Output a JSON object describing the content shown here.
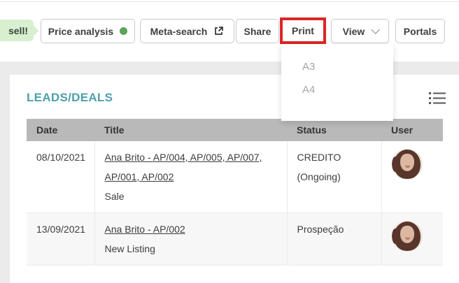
{
  "toolbar": {
    "sell_badge_label": "sell!",
    "buttons": [
      {
        "label": "Price analysis"
      },
      {
        "label": "Meta-search"
      },
      {
        "label": "Share"
      },
      {
        "label": "Print"
      },
      {
        "label": "View"
      },
      {
        "label": "Portals"
      }
    ]
  },
  "print_menu": {
    "items": [
      "A3",
      "A4"
    ]
  },
  "panel": {
    "title": "LEADS/DEALS"
  },
  "table": {
    "columns": [
      "Date",
      "Title",
      "Status",
      "User"
    ],
    "rows": [
      {
        "date": "08/10/2021",
        "title_link": "Ana Brito - AP/004, AP/005, AP/007, AP/001, AP/002",
        "subtitle": "Sale",
        "status": "CREDITO (Ongoing)"
      },
      {
        "date": "13/09/2021",
        "title_link": "Ana Brito - AP/002",
        "subtitle": "New Listing",
        "status": "Prospeção"
      }
    ]
  },
  "icons": {
    "price_analysis_dot": "green-status-dot",
    "meta_search": "external-link-icon",
    "view": "chevron-down-icon",
    "panel": "list-view-icon",
    "user": "user-avatar-photo"
  },
  "colors": {
    "accent_teal": "#4d9fac",
    "highlight_red": "#dd2626",
    "status_green": "#5aa55a",
    "badge_green_bg": "#d8efd0",
    "table_header_gray": "#b9b9b9",
    "page_background": "#ebebeb"
  }
}
